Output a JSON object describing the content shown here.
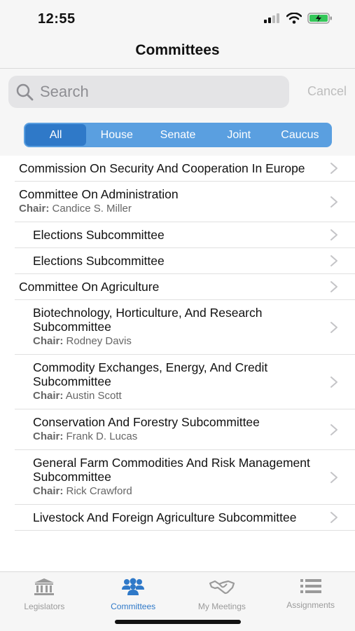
{
  "status": {
    "time": "12:55"
  },
  "nav": {
    "title": "Committees"
  },
  "search": {
    "placeholder": "Search",
    "cancel_label": "Cancel"
  },
  "segments": [
    "All",
    "House",
    "Senate",
    "Joint",
    "Caucus"
  ],
  "selected_segment": "All",
  "chair_label": "Chair:",
  "rows": [
    {
      "title": "Commission On Security And Cooperation In Europe",
      "chair": "",
      "sub": false
    },
    {
      "title": "Committee On Administration",
      "chair": "Candice S. Miller",
      "sub": false
    },
    {
      "title": "Elections Subcommittee",
      "chair": "",
      "sub": true
    },
    {
      "title": "Elections Subcommittee",
      "chair": "",
      "sub": true
    },
    {
      "title": "Committee On Agriculture",
      "chair": "",
      "sub": false
    },
    {
      "title": "Biotechnology, Horticulture, And Research Subcommittee",
      "chair": "Rodney Davis",
      "sub": true
    },
    {
      "title": "Commodity Exchanges, Energy, And Credit Subcommittee",
      "chair": "Austin Scott",
      "sub": true
    },
    {
      "title": "Conservation And Forestry Subcommittee",
      "chair": "Frank D. Lucas",
      "sub": true
    },
    {
      "title": "General Farm Commodities And Risk Management Subcommittee",
      "chair": "Rick Crawford",
      "sub": true
    },
    {
      "title": "Livestock And Foreign Agriculture Subcommittee",
      "chair": "",
      "sub": true
    }
  ],
  "tabs": [
    {
      "label": "Legislators",
      "icon": "capitol-icon",
      "active": false
    },
    {
      "label": "Committees",
      "icon": "people-group-icon",
      "active": true
    },
    {
      "label": "My Meetings",
      "icon": "handshake-icon",
      "active": false
    },
    {
      "label": "Assignments",
      "icon": "list-icon",
      "active": false
    }
  ],
  "colors": {
    "accent": "#2f79c8",
    "segment_bg": "#5a9fe0",
    "inactive_tab": "#9a9a9a"
  }
}
